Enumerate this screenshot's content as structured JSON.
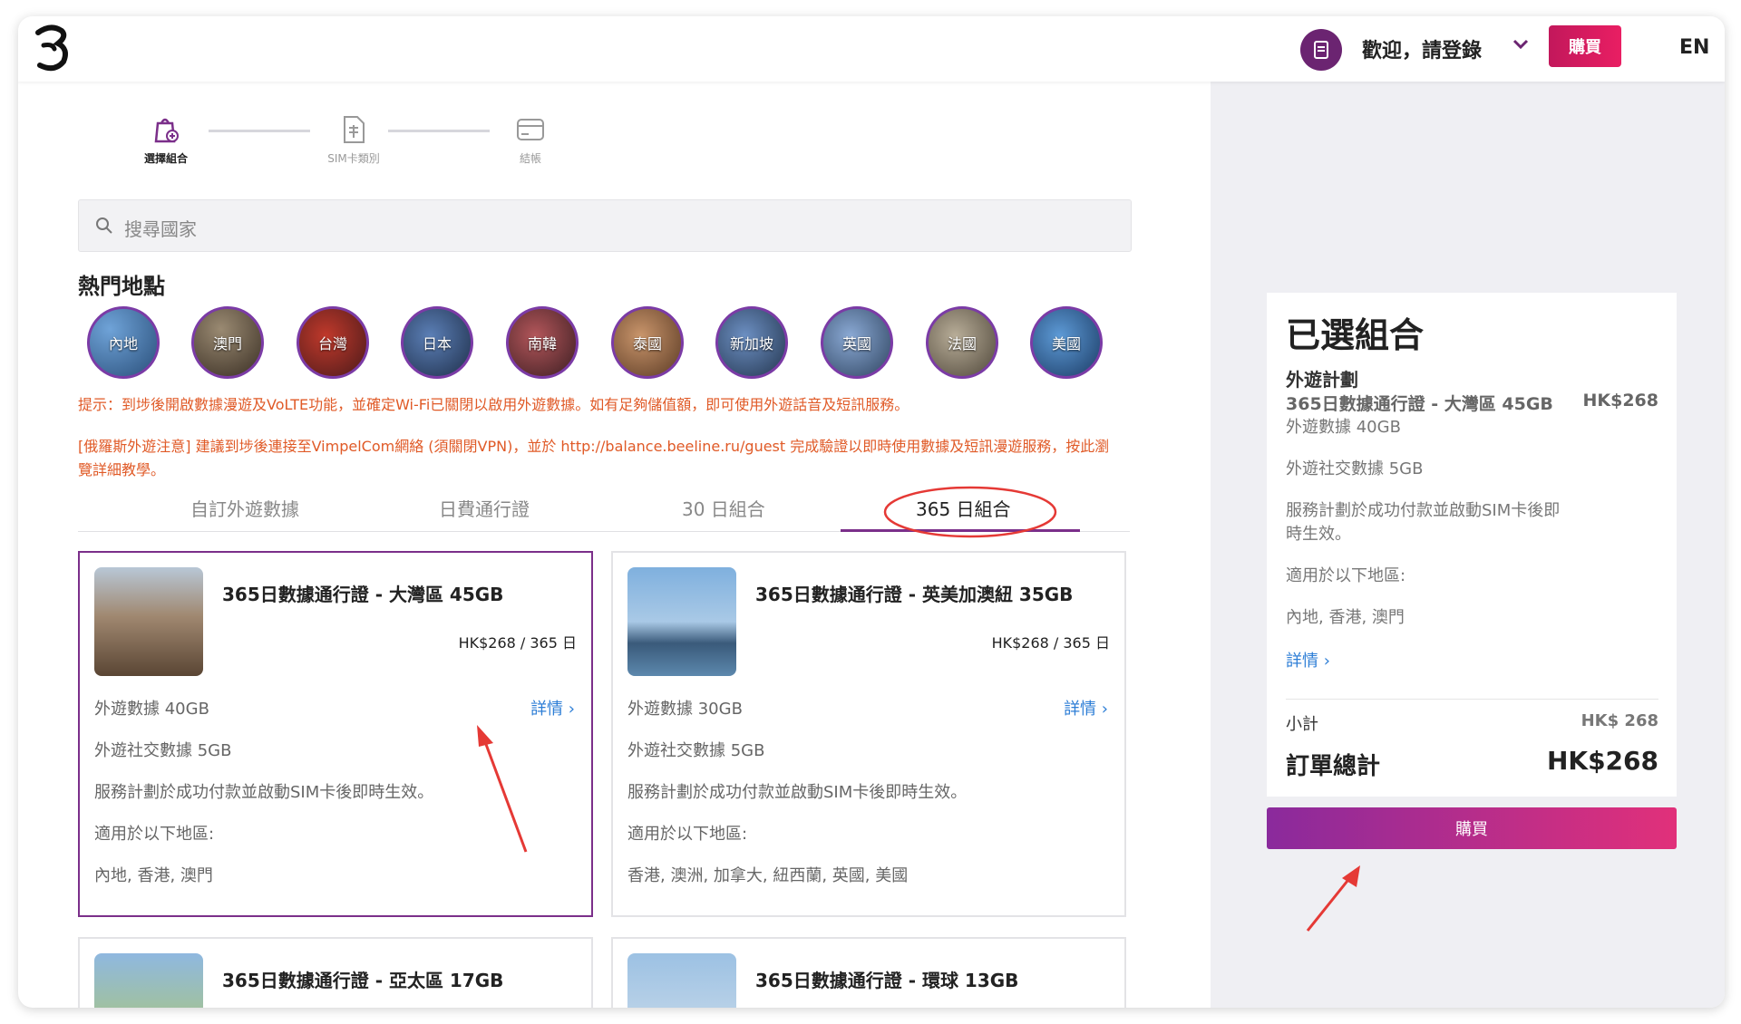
{
  "header": {
    "welcome": "歡迎，請登錄",
    "buy_label": "購買",
    "lang": "EN"
  },
  "stepper": [
    {
      "label": "選擇組合",
      "icon": "bag-plus-icon"
    },
    {
      "label": "SIM卡類別",
      "icon": "sim-card-icon"
    },
    {
      "label": "結帳",
      "icon": "credit-card-icon"
    }
  ],
  "search": {
    "placeholder": "搜尋國家"
  },
  "popular": {
    "title": "熱門地點",
    "items": [
      "內地",
      "澳門",
      "台灣",
      "日本",
      "南韓",
      "泰國",
      "新加坡",
      "英國",
      "法國",
      "美國"
    ]
  },
  "tips": {
    "tip1": "提示：到埗後開啟數據漫遊及VoLTE功能，並確定Wi-Fi已關閉以啟用外遊數據。如有足夠儲值額，即可使用外遊話音及短訊服務。",
    "tip2a": "[俄羅斯外遊注意] 建議到埗後連接至VimpelCom網絡 (須關閉VPN)，並於 http://balance.beeline.ru/guest 完成驗證以即時使用數據及短訊漫遊服務，按此瀏",
    "tip2b": "覽詳細教學。"
  },
  "tabs": [
    "自訂外遊數據",
    "日費通行證",
    "30 日組合",
    "365 日組合"
  ],
  "cards": [
    {
      "title": "365日數據通行證 - 大灣區 45GB",
      "price": "HK$268 / 365 日",
      "data": "外遊數據 40GB",
      "social": "外遊社交數據 5GB",
      "note": "服務計劃於成功付款並啟動SIM卡後即時生效。",
      "region_label": "適用於以下地區:",
      "regions": "內地, 香港, 澳門",
      "detail": "詳情"
    },
    {
      "title": "365日數據通行證 - 英美加澳紐 35GB",
      "price": "HK$268 / 365 日",
      "data": "外遊數據 30GB",
      "social": "外遊社交數據 5GB",
      "note": "服務計劃於成功付款並啟動SIM卡後即時生效。",
      "region_label": "適用於以下地區:",
      "regions": "香港, 澳洲, 加拿大, 紐西蘭, 英國, 美國",
      "detail": "詳情"
    },
    {
      "title": "365日數據通行證 - 亞太區 17GB"
    },
    {
      "title": "365日數據通行證 - 環球 13GB"
    }
  ],
  "summary": {
    "title": "已選組合",
    "plan_label": "外遊計劃",
    "item": "365日數據通行證 - 大灣區 45GB",
    "item_price": "HK$268",
    "data": "外遊數據 40GB",
    "social": "外遊社交數據 5GB",
    "note1": "服務計劃於成功付款並啟動SIM卡後即",
    "note2": "時生效。",
    "region_label": "適用於以下地區:",
    "regions": "內地, 香港, 澳門",
    "detail": "詳情",
    "subtotal_label": "小計",
    "subtotal": "HK$ 268",
    "total_label": "訂單總計",
    "total": "HK$268",
    "buy_label": "購買"
  },
  "colors": {
    "brand": "#7b2f8a",
    "accent": "#e91e63",
    "tip": "#e05a27",
    "link": "#2d7ed6"
  }
}
